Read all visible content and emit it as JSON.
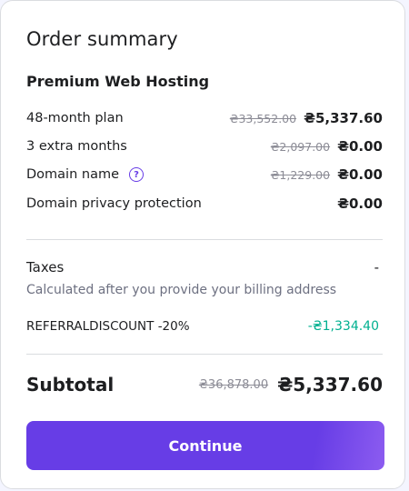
{
  "summary": {
    "title": "Order summary",
    "product": "Premium Web Hosting",
    "items": [
      {
        "label": "48-month plan",
        "old_price": "₴33,552.00",
        "price": "₴5,337.60"
      },
      {
        "label": "3 extra months",
        "old_price": "₴2,097.00",
        "price": "₴0.00"
      },
      {
        "label": "Domain name",
        "old_price": "₴1,229.00",
        "price": "₴0.00",
        "help_icon": "question-circle-icon"
      },
      {
        "label": "Domain privacy protection",
        "old_price": "",
        "price": "₴0.00"
      }
    ],
    "taxes": {
      "label": "Taxes",
      "value": "-",
      "note": "Calculated after you provide your billing address"
    },
    "discount": {
      "code": "REFERRALDISCOUNT -20%",
      "value": "-₴1,334.40"
    },
    "subtotal": {
      "label": "Subtotal",
      "old_price": "₴36,878.00",
      "price": "₴5,337.60"
    },
    "continue_label": "Continue"
  },
  "colors": {
    "accent": "#673de6",
    "discount": "#00b090",
    "text": "#1d1e20",
    "muted": "#6d7081"
  }
}
